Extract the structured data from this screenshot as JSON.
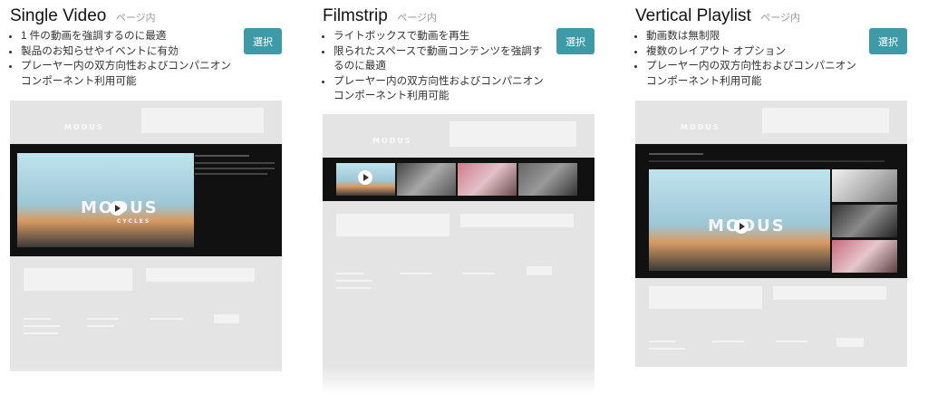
{
  "cards": [
    {
      "title": "Single Video",
      "sub": "ページ内",
      "bullets": [
        "1 件の動画を強調するのに最適",
        "製品のお知らせやイベントに有効",
        "プレーヤー内の双方向性およびコンパニオン コンポーネント利用可能"
      ],
      "button": "選択"
    },
    {
      "title": "Filmstrip",
      "sub": "ページ内",
      "bullets": [
        "ライトボックスで動画を再生",
        "限られたスペースで動画コンテンツを強調するのに最適",
        "プレーヤー内の双方向性およびコンパニオン コンポーネント利用可能"
      ],
      "button": "選択"
    },
    {
      "title": "Vertical Playlist",
      "sub": "ページ内",
      "bullets": [
        "動画数は無制限",
        "複数のレイアウト オプション",
        "プレーヤー内の双方向性およびコンパニオン コンポーネント利用可能"
      ],
      "button": "選択"
    }
  ],
  "preview": {
    "logo": "MODUS",
    "brand": "MODUS",
    "brand_sub": "CYCLES"
  },
  "colors": {
    "button": "#3f9aa7",
    "thumb_bg": "#e4e4e4",
    "player_bg": "#111111"
  }
}
